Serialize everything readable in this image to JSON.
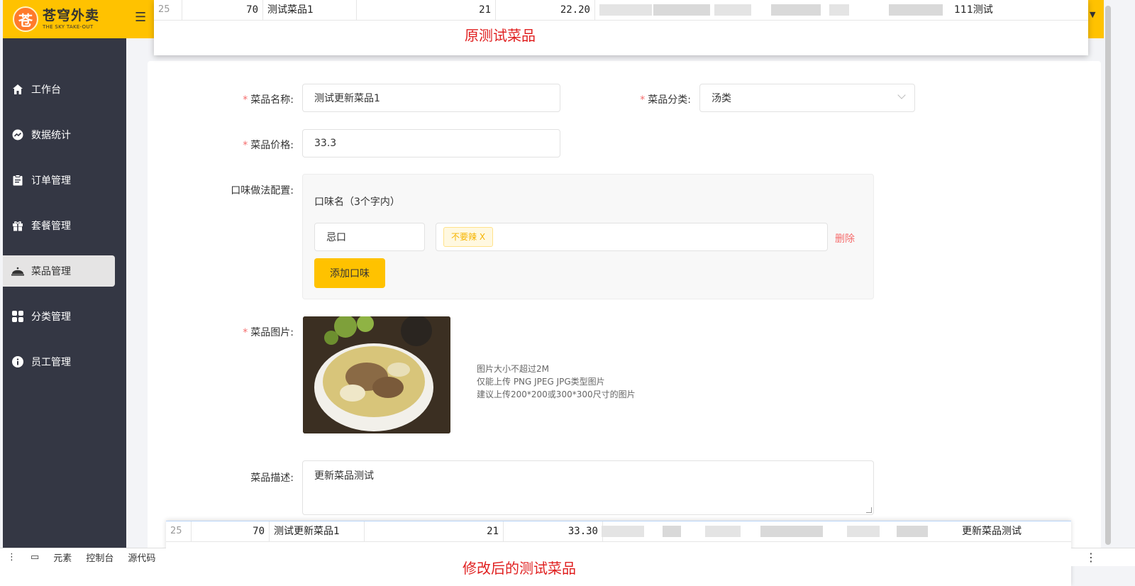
{
  "brand": {
    "name_cn": "苍穹外卖",
    "name_en": "THE SKY TAKE-OUT",
    "logo_glyph": "苍",
    "accent": "#ffc200"
  },
  "sidebar": {
    "items": [
      {
        "label": "工作台",
        "icon": "home-icon"
      },
      {
        "label": "数据统计",
        "icon": "chart-icon"
      },
      {
        "label": "订单管理",
        "icon": "clipboard-icon"
      },
      {
        "label": "套餐管理",
        "icon": "gift-icon"
      },
      {
        "label": "菜品管理",
        "icon": "dish-cover-icon",
        "active": true
      },
      {
        "label": "分类管理",
        "icon": "grid-icon"
      },
      {
        "label": "员工管理",
        "icon": "info-icon"
      }
    ]
  },
  "form": {
    "name_label": "菜品名称:",
    "name_value": "测试更新菜品1",
    "category_label": "菜品分类:",
    "category_value": "汤类",
    "price_label": "菜品价格:",
    "price_value": "33.3",
    "flavor_label": "口味做法配置:",
    "flavor_header": "口味名（3个字内）",
    "flavor_name": "忌口",
    "flavor_tag": "不要辣 X",
    "flavor_delete": "删除",
    "add_flavor": "添加口味",
    "image_label": "菜品图片:",
    "image_hints": [
      "图片大小不超过2M",
      "仅能上传 PNG JPEG JPG类型图片",
      "建议上传200*200或300*300尺寸的图片"
    ],
    "desc_label": "菜品描述:",
    "desc_value": "更新菜品测试",
    "required_mark": "*"
  },
  "top_row": {
    "index": "25",
    "category_id": "70",
    "name": "测试菜品1",
    "num": "21",
    "price": "22.20",
    "desc": "111测试",
    "note": "原测试菜品"
  },
  "bottom_row": {
    "index": "25",
    "category_id": "70",
    "name": "测试更新菜品1",
    "num": "21",
    "price": "33.30",
    "desc": "更新菜品测试",
    "note": "修改后的测试菜品"
  },
  "devtools": {
    "tabs": [
      "元素",
      "控制台",
      "源代码"
    ]
  }
}
